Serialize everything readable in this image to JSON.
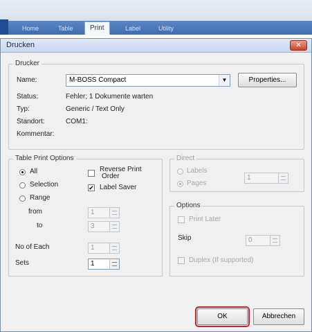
{
  "ribbon": {
    "tabs": [
      "Home",
      "Table",
      "Print",
      "Label",
      "Utility"
    ],
    "active_tab": "Print"
  },
  "dialog": {
    "title": "Drucken",
    "close_symbol": "✕",
    "printer": {
      "legend": "Drucker",
      "name_label": "Name:",
      "name_value": "M-BOSS Compact",
      "properties_button": "Properties...",
      "status_label": "Status:",
      "status_value": "Fehler; 1 Dokumente warten",
      "type_label": "Typ:",
      "type_value": "Generic / Text Only",
      "location_label": "Standort:",
      "location_value": "COM1:",
      "comment_label": "Kommentar:"
    },
    "table_print_options": {
      "legend": "Table Print Options",
      "all": "All",
      "selection": "Selection",
      "range": "Range",
      "selected": "All",
      "from_label": "from",
      "from_value": "1",
      "to_label": "to",
      "to_value": "3",
      "reverse_print_order_line1": "Reverse Print",
      "reverse_print_order_line2": "Order",
      "reverse_print_order_checked": false,
      "label_saver": "Label Saver",
      "label_saver_checked": true,
      "no_of_each_label": "No of Each",
      "no_of_each_value": "1",
      "sets_label": "Sets",
      "sets_value": "1"
    },
    "direct": {
      "legend": "Direct",
      "labels": "Labels",
      "pages": "Pages",
      "selected": "Pages",
      "value": "1"
    },
    "options": {
      "legend": "Options",
      "print_later": "Print Later",
      "skip_label": "Skip",
      "skip_value": "0",
      "duplex": "Duplex (If supported)"
    },
    "buttons": {
      "ok": "OK",
      "cancel": "Abbrechen"
    }
  }
}
